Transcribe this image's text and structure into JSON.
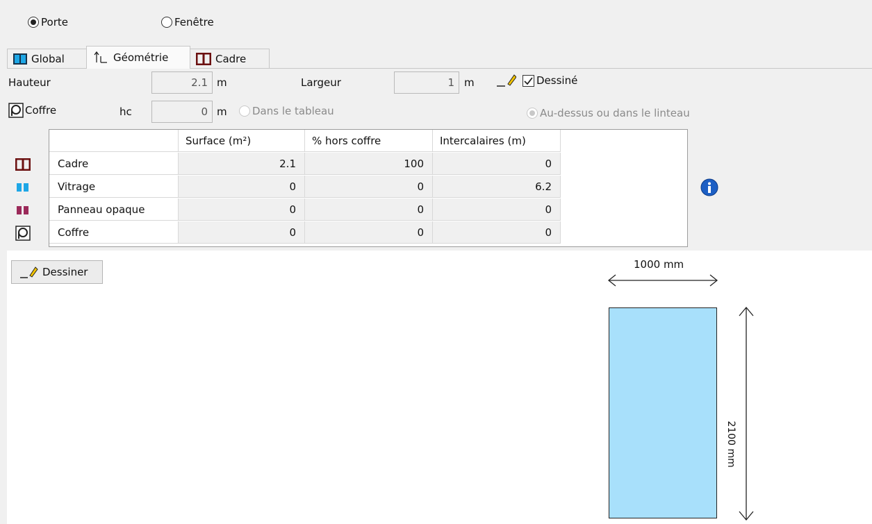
{
  "type_radio": {
    "options": [
      "Porte",
      "Fenêtre"
    ],
    "selected": "Porte"
  },
  "tabs": [
    {
      "label": "Global",
      "icon": "glazing-icon"
    },
    {
      "label": "Géométrie",
      "icon": "dimension-icon",
      "active": true
    },
    {
      "label": "Cadre",
      "icon": "frame-icon"
    }
  ],
  "geometry": {
    "hauteur_label": "Hauteur",
    "hauteur_value": "2.1",
    "hauteur_unit": "m",
    "largeur_label": "Largeur",
    "largeur_value": "1",
    "largeur_unit": "m",
    "dessine_label": "Dessiné",
    "dessine_checked": true,
    "coffre_label": "Coffre",
    "hc_label": "hc",
    "hc_value": "0",
    "hc_unit": "m",
    "dans_tableau_label": "Dans le tableau",
    "au_dessus_label": "Au-dessus ou dans le linteau"
  },
  "table": {
    "headers": [
      "Surface (m²)",
      "% hors coffre",
      "Intercalaires (m)"
    ],
    "rows": [
      {
        "label": "Cadre",
        "values": [
          "2.1",
          "100",
          "0"
        ],
        "icon": "frame-icon"
      },
      {
        "label": "Vitrage",
        "values": [
          "0",
          "0",
          "6.2"
        ],
        "icon": "glazing-icon"
      },
      {
        "label": "Panneau opaque",
        "values": [
          "0",
          "0",
          "0"
        ],
        "icon": "opaque-panel-icon"
      },
      {
        "label": "Coffre",
        "values": [
          "0",
          "0",
          "0"
        ],
        "icon": "shutter-box-icon"
      }
    ]
  },
  "draw_button_label": "Dessiner",
  "drawing": {
    "width_label": "1000 mm",
    "height_label": "2100 mm",
    "fill_color": "#a8e0fb"
  },
  "colors": {
    "frame": "#6b1010",
    "glazing": "#1ea7e6",
    "opaque": "#9b2a5a"
  }
}
